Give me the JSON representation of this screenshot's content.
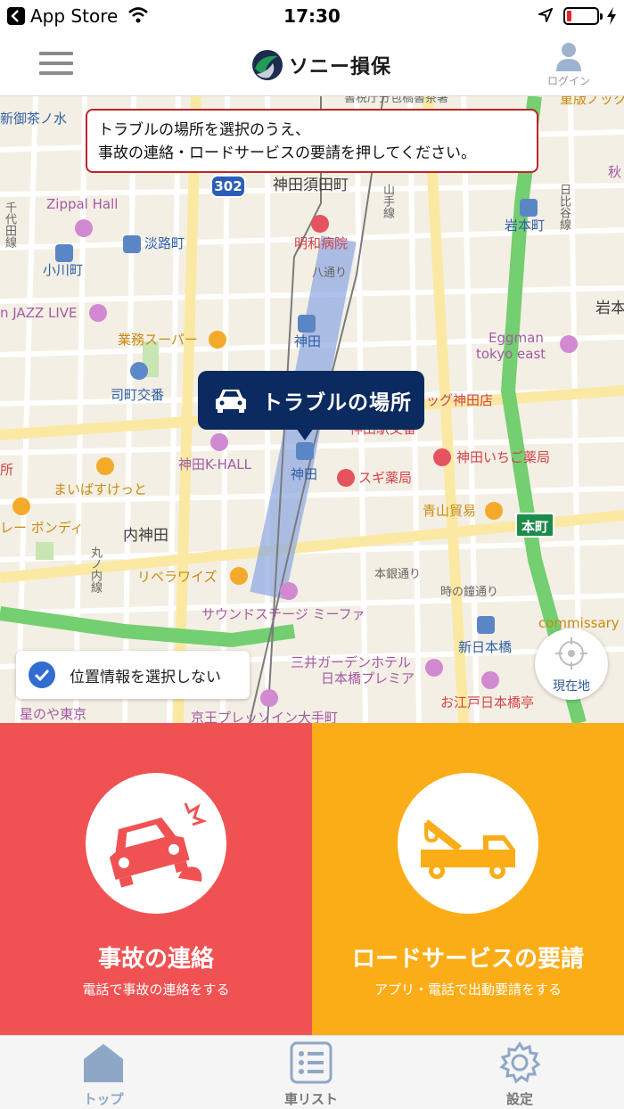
{
  "status_bar": {
    "carrier": "App Store",
    "time": "17:30",
    "icons": [
      "back-icon",
      "wifi-icon",
      "location-arrow-icon",
      "battery-icon",
      "charging-bolt-icon"
    ]
  },
  "header": {
    "logo_text": "ソニー損保",
    "login_label": "ログイン"
  },
  "map": {
    "notice_line1": "トラブルの場所を選択のうえ、",
    "notice_line2": "事故の連絡・ロードサービスの要請を押してください。",
    "pin_label": "トラブルの場所",
    "location_toggle_label": "位置情報を選択しない",
    "current_location_label": "現在地",
    "route_badge": "302",
    "station_badge": "本町",
    "labels": {
      "l1": "新御茶ノ水",
      "l2": "神田須田町",
      "l3": "Zippal Hall",
      "l4": "淡路町",
      "l5": "明和病院",
      "l6": "岩本町",
      "l7": "小川町",
      "l8": "千代田線",
      "l9": "n JAZZ LIVE",
      "l10": "業務スーパー",
      "l11": "神田",
      "l12": "Eggman",
      "l13": "tokyo east",
      "l14": "司町交番",
      "l15": "ッグ神田店",
      "l16": "神田K-HALL",
      "l17": "神田",
      "l18": "神田いちご薬局",
      "l19": "スギ薬局",
      "l20": "まいばすけっと",
      "l21": "レー ボンディ",
      "l22": "青山貿易",
      "l23": "内神田",
      "l24": "リベラワイズ",
      "l25": "丸ノ内線",
      "l26": "サウンドステージ ミーファ",
      "l27": "新日本橋",
      "l28": "三井ガーデンホテル",
      "l29": "日本橋プレミア",
      "l30": "お江戸日本橋亭",
      "l31": "星のや東京",
      "l32": "commissary",
      "l33": "岩本",
      "l34": "秋",
      "l35": "日比谷線",
      "l36": "山手線",
      "l37": "八通り",
      "l38": "本銀通り",
      "l39": "時の鐘通り",
      "l40": "所",
      "l41": "京王プレッソイン大手町",
      "l42": "書税庁分包橋書茶署",
      "l43": "重版ノック",
      "l44": "神田駅交番"
    }
  },
  "actions": {
    "accident": {
      "title": "事故の連絡",
      "subtitle": "電話で事故の連絡をする",
      "icon": "car-crash-icon",
      "color": "#f05253"
    },
    "road": {
      "title": "ロードサービスの要請",
      "subtitle": "アプリ・電話で出動要請をする",
      "icon": "tow-truck-icon",
      "color": "#fbad18"
    }
  },
  "tabbar": {
    "top": "トップ",
    "cars": "車リスト",
    "settings": "設定"
  }
}
